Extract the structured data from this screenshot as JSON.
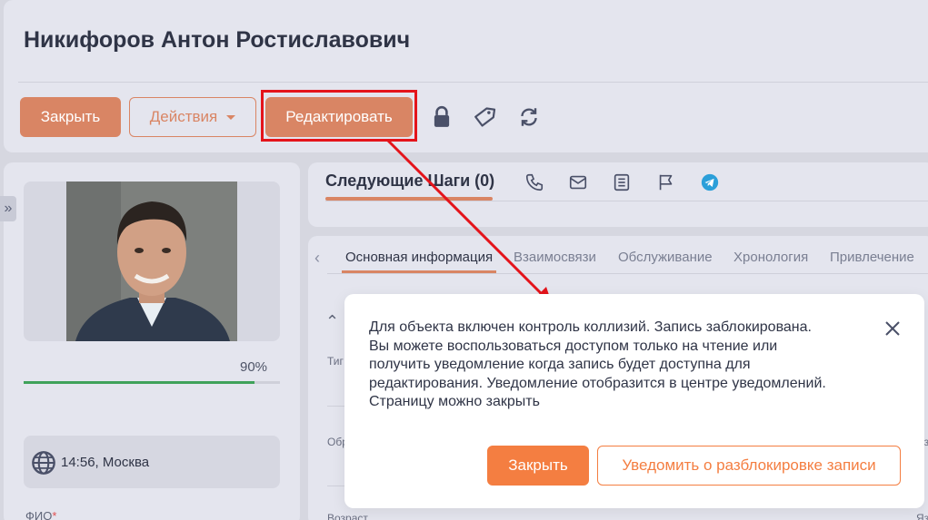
{
  "header": {
    "title": "Никифоров Антон Ростиславович",
    "close_label": "Закрыть",
    "actions_label": "Действия",
    "edit_label": "Редактировать"
  },
  "profile": {
    "completion": "90%",
    "completion_fraction": 0.9,
    "time": "14:56,",
    "city": "Москва",
    "fio_label": "ФИО",
    "fio_required": "*"
  },
  "next_steps": {
    "label": "Следующие Шаги (0)"
  },
  "tabs": [
    {
      "label": "Основная информация"
    },
    {
      "label": "Взаимосвязи"
    },
    {
      "label": "Обслуживание"
    },
    {
      "label": "Хронология"
    },
    {
      "label": "Привлечение"
    }
  ],
  "fields": {
    "type_label_partial": "Тиг",
    "obr_label_partial": "Обр",
    "age_label_partial": "Возраст",
    "right_label_1": "Л",
    "right_label_2": "Яз",
    "right_label_3": "Яз"
  },
  "dialog": {
    "lines": [
      "Для объекта включен контроль коллизий. Запись заблокирована.",
      "Вы можете воспользоваться доступом только на чтение или",
      "получить уведомление когда запись будет доступна для",
      "редактирования. Уведомление отобразится в центре уведомлений.",
      "Страницу можно закрыть"
    ],
    "close_label": "Закрыть",
    "notify_label": "Уведомить о разблокировке записи"
  },
  "colors": {
    "accent": "#d98564",
    "dialog_accent": "#f47e41",
    "highlight": "#e4141b",
    "progress": "#3fa25a",
    "telegram": "#2b9fd9"
  }
}
